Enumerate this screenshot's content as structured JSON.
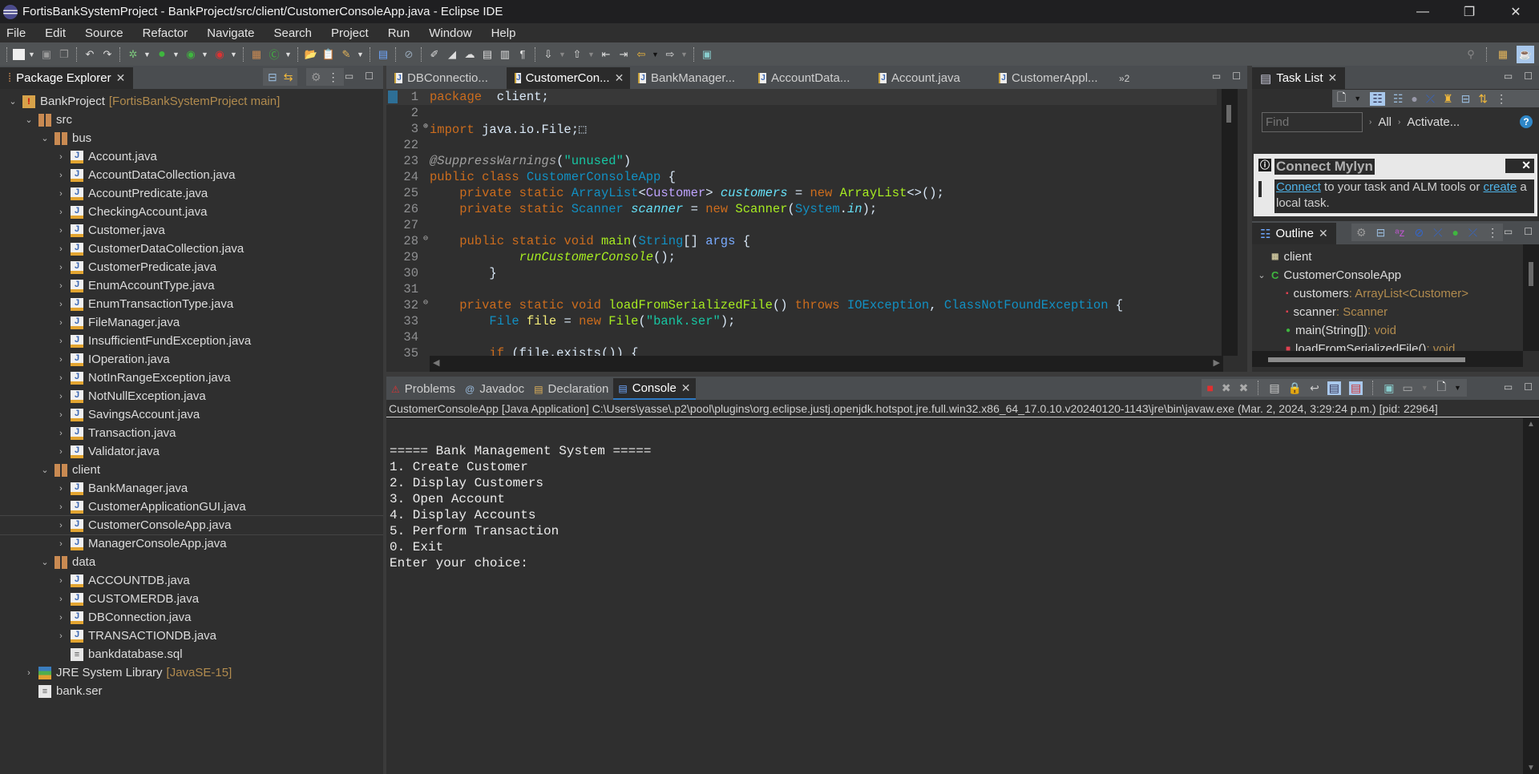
{
  "window": {
    "title": "FortisBankSystemProject - BankProject/src/client/CustomerConsoleApp.java - Eclipse IDE",
    "controls": {
      "minimize": "—",
      "restore": "❐",
      "close": "✕"
    }
  },
  "menu": [
    "File",
    "Edit",
    "Source",
    "Refactor",
    "Navigate",
    "Search",
    "Project",
    "Run",
    "Window",
    "Help"
  ],
  "package_explorer": {
    "tab_label": "Package Explorer",
    "tree": [
      {
        "label": "BankProject",
        "decoration": "[FortisBankSystemProject main]",
        "icon": "project-icon",
        "level": 0,
        "twisty": "v"
      },
      {
        "label": "src",
        "icon": "source-folder-icon",
        "level": 1,
        "twisty": "v"
      },
      {
        "label": "bus",
        "icon": "package-icon",
        "level": 2,
        "twisty": "v"
      },
      {
        "label": "Account.java",
        "icon": "java-file-icon",
        "level": 3,
        "twisty": ">"
      },
      {
        "label": "AccountDataCollection.java",
        "icon": "java-file-icon",
        "level": 3,
        "twisty": ">"
      },
      {
        "label": "AccountPredicate.java",
        "icon": "java-file-icon",
        "level": 3,
        "twisty": ">"
      },
      {
        "label": "CheckingAccount.java",
        "icon": "java-file-icon",
        "level": 3,
        "twisty": ">"
      },
      {
        "label": "Customer.java",
        "icon": "java-file-icon",
        "level": 3,
        "twisty": ">"
      },
      {
        "label": "CustomerDataCollection.java",
        "icon": "java-file-icon",
        "level": 3,
        "twisty": ">"
      },
      {
        "label": "CustomerPredicate.java",
        "icon": "java-file-icon",
        "level": 3,
        "twisty": ">"
      },
      {
        "label": "EnumAccountType.java",
        "icon": "java-file-icon",
        "level": 3,
        "twisty": ">"
      },
      {
        "label": "EnumTransactionType.java",
        "icon": "java-file-icon",
        "level": 3,
        "twisty": ">"
      },
      {
        "label": "FileManager.java",
        "icon": "java-file-icon",
        "level": 3,
        "twisty": ">"
      },
      {
        "label": "InsufficientFundException.java",
        "icon": "java-file-icon",
        "level": 3,
        "twisty": ">"
      },
      {
        "label": "IOperation.java",
        "icon": "java-file-icon",
        "level": 3,
        "twisty": ">"
      },
      {
        "label": "NotInRangeException.java",
        "icon": "java-file-icon",
        "level": 3,
        "twisty": ">"
      },
      {
        "label": "NotNullException.java",
        "icon": "java-file-icon",
        "level": 3,
        "twisty": ">"
      },
      {
        "label": "SavingsAccount.java",
        "icon": "java-file-icon",
        "level": 3,
        "twisty": ">"
      },
      {
        "label": "Transaction.java",
        "icon": "java-file-icon",
        "level": 3,
        "twisty": ">"
      },
      {
        "label": "Validator.java",
        "icon": "java-file-icon",
        "level": 3,
        "twisty": ">"
      },
      {
        "label": "client",
        "icon": "package-icon",
        "level": 2,
        "twisty": "v"
      },
      {
        "label": "BankManager.java",
        "icon": "java-file-icon",
        "level": 3,
        "twisty": ">"
      },
      {
        "label": "CustomerApplicationGUI.java",
        "icon": "java-file-icon",
        "level": 3,
        "twisty": ">"
      },
      {
        "label": "CustomerConsoleApp.java",
        "icon": "java-file-icon",
        "level": 3,
        "twisty": ">",
        "selected": true
      },
      {
        "label": "ManagerConsoleApp.java",
        "icon": "java-file-icon",
        "level": 3,
        "twisty": ">"
      },
      {
        "label": "data",
        "icon": "package-icon",
        "level": 2,
        "twisty": "v"
      },
      {
        "label": "ACCOUNTDB.java",
        "icon": "java-file-icon",
        "level": 3,
        "twisty": ">"
      },
      {
        "label": "CUSTOMERDB.java",
        "icon": "java-file-icon",
        "level": 3,
        "twisty": ">"
      },
      {
        "label": "DBConnection.java",
        "icon": "java-file-icon",
        "level": 3,
        "twisty": ">"
      },
      {
        "label": "TRANSACTIONDB.java",
        "icon": "java-file-icon",
        "level": 3,
        "twisty": ">"
      },
      {
        "label": "bankdatabase.sql",
        "icon": "text-file-icon",
        "level": 3,
        "twisty": ""
      },
      {
        "label": "JRE System Library",
        "decoration": "[JavaSE-15]",
        "icon": "library-icon",
        "level": 1,
        "twisty": ">"
      },
      {
        "label": "bank.ser",
        "icon": "text-file-icon",
        "level": 1,
        "twisty": ""
      }
    ]
  },
  "editor": {
    "tabs": [
      {
        "label": "DBConnectio...",
        "active": false
      },
      {
        "label": "CustomerCon...",
        "active": true
      },
      {
        "label": "BankManager...",
        "active": false
      },
      {
        "label": "AccountData...",
        "active": false
      },
      {
        "label": "Account.java",
        "active": false
      },
      {
        "label": "CustomerAppl...",
        "active": false
      }
    ],
    "overflow_label": "»2",
    "lines": [
      {
        "n": "1",
        "tokens": [
          [
            "kw",
            "package"
          ],
          [
            "",
            "  client;"
          ]
        ]
      },
      {
        "n": "2",
        "tokens": []
      },
      {
        "n": "3",
        "fold": "+",
        "tokens": [
          [
            "kw",
            "import"
          ],
          [
            "",
            " java.io.File;"
          ],
          [
            "",
            "⬚"
          ]
        ]
      },
      {
        "n": "22",
        "tokens": []
      },
      {
        "n": "23",
        "tokens": [
          [
            "ann",
            "@SuppressWarnings"
          ],
          [
            "",
            "("
          ],
          [
            "str",
            "\"unused\""
          ],
          [
            "",
            ")"
          ]
        ]
      },
      {
        "n": "24",
        "tokens": [
          [
            "kw",
            "public class "
          ],
          [
            "ty",
            "CustomerConsoleApp"
          ],
          [
            "",
            " {"
          ]
        ]
      },
      {
        "n": "25",
        "tokens": [
          [
            "",
            "    "
          ],
          [
            "kw",
            "private static "
          ],
          [
            "ty",
            "ArrayList"
          ],
          [
            "",
            "<"
          ],
          [
            "gen",
            "Customer"
          ],
          [
            "",
            "> "
          ],
          [
            "fld",
            "customers"
          ],
          [
            "",
            " = "
          ],
          [
            "kw",
            "new "
          ],
          [
            "mth",
            "ArrayList"
          ],
          [
            "",
            "<>();"
          ]
        ]
      },
      {
        "n": "26",
        "tokens": [
          [
            "",
            "    "
          ],
          [
            "kw",
            "private static "
          ],
          [
            "ty",
            "Scanner "
          ],
          [
            "fld",
            "scanner"
          ],
          [
            "",
            " = "
          ],
          [
            "kw",
            "new "
          ],
          [
            "mth",
            "Scanner"
          ],
          [
            "",
            "("
          ],
          [
            "ty",
            "System"
          ],
          [
            "",
            "."
          ],
          [
            "fld",
            "in"
          ],
          [
            "",
            ");"
          ]
        ]
      },
      {
        "n": "27",
        "tokens": []
      },
      {
        "n": "28",
        "fold": "-",
        "tokens": [
          [
            "",
            "    "
          ],
          [
            "kw",
            "public static void "
          ],
          [
            "mth",
            "main"
          ],
          [
            "",
            "("
          ],
          [
            "ty",
            "String"
          ],
          [
            "",
            "[] "
          ],
          [
            "par",
            "args"
          ],
          [
            "",
            " {"
          ]
        ]
      },
      {
        "n": "29",
        "tokens": [
          [
            "",
            "            "
          ],
          [
            "mth itl",
            "runCustomerConsole"
          ],
          [
            "",
            "();"
          ]
        ]
      },
      {
        "n": "30",
        "tokens": [
          [
            "",
            "        }"
          ]
        ]
      },
      {
        "n": "31",
        "tokens": []
      },
      {
        "n": "32",
        "fold": "-",
        "tokens": [
          [
            "",
            "    "
          ],
          [
            "kw",
            "private static void "
          ],
          [
            "mth",
            "loadFromSerializedFile"
          ],
          [
            "",
            "() "
          ],
          [
            "kw",
            "throws "
          ],
          [
            "ty",
            "IOException"
          ],
          [
            "",
            ", "
          ],
          [
            "ty",
            "ClassNotFoundException"
          ],
          [
            "",
            " {"
          ]
        ]
      },
      {
        "n": "33",
        "tokens": [
          [
            "",
            "        "
          ],
          [
            "ty",
            "File "
          ],
          [
            "loc",
            "file"
          ],
          [
            "",
            " = "
          ],
          [
            "kw",
            "new "
          ],
          [
            "mth",
            "File"
          ],
          [
            "",
            "("
          ],
          [
            "str",
            "\"bank.ser\""
          ],
          [
            "",
            ");"
          ]
        ]
      },
      {
        "n": "34",
        "tokens": []
      },
      {
        "n": "35",
        "tokens": [
          [
            "",
            "        "
          ],
          [
            "kw",
            "if "
          ],
          [
            "",
            "(file.exists()) {"
          ]
        ]
      }
    ]
  },
  "task_list": {
    "tab_label": "Task List",
    "find_placeholder": "Find",
    "all_label": "All",
    "activate_label": "Activate...",
    "mylyn": {
      "title": "Connect Mylyn",
      "connect_link": "Connect",
      "middle_text": " to your task and ALM tools or ",
      "create_link": "create",
      "end_text": " a local task."
    }
  },
  "outline": {
    "tab_label": "Outline",
    "items": [
      {
        "label": "client",
        "type": "",
        "icon": "package-icon",
        "level": 0
      },
      {
        "label": "CustomerConsoleApp",
        "type": "",
        "icon": "class-icon",
        "level": 0,
        "twisty": "v"
      },
      {
        "label": "customers",
        "type": " : ArrayList<Customer>",
        "icon": "private-field-icon",
        "level": 1
      },
      {
        "label": "scanner",
        "type": " : Scanner",
        "icon": "private-field-icon",
        "level": 1
      },
      {
        "label": "main(String[])",
        "type": " : void",
        "icon": "public-method-icon",
        "level": 1
      },
      {
        "label": "loadFromSerializedFile()",
        "type": " : void",
        "icon": "private-method-icon",
        "level": 1
      }
    ]
  },
  "bottom": {
    "tabs": [
      {
        "label": "Problems",
        "icon": "problems-icon",
        "active": false
      },
      {
        "label": "Javadoc",
        "icon": "javadoc-icon",
        "active": false
      },
      {
        "label": "Declaration",
        "icon": "declaration-icon",
        "active": false
      },
      {
        "label": "Console",
        "icon": "console-icon",
        "active": true
      }
    ],
    "console_header": "CustomerConsoleApp [Java Application] C:\\Users\\yasse\\.p2\\pool\\plugins\\org.eclipse.justj.openjdk.hotspot.jre.full.win32.x86_64_17.0.10.v20240120-1143\\jre\\bin\\javaw.exe  (Mar. 2, 2024, 3:29:24 p.m.) [pid: 22964]",
    "console_output": [
      "",
      "===== Bank Management System =====",
      "1. Create Customer",
      "2. Display Customers",
      "3. Open Account",
      "4. Display Accounts",
      "5. Perform Transaction",
      "0. Exit",
      "Enter your choice:"
    ]
  }
}
